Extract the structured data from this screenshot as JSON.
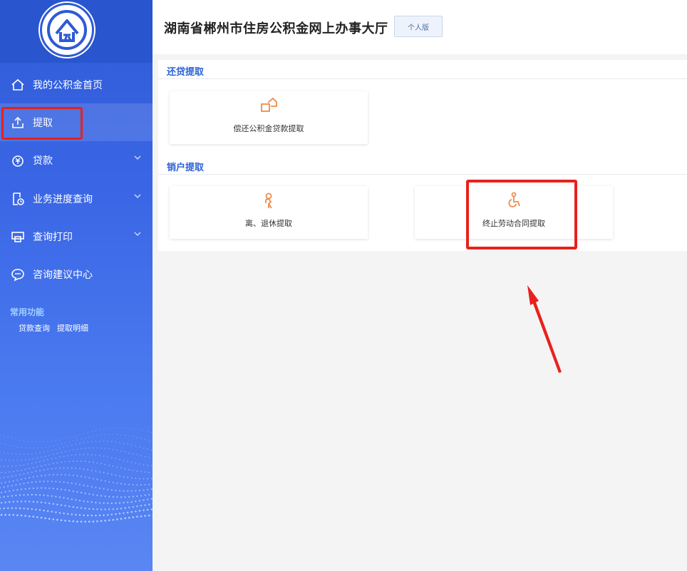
{
  "sidebar": {
    "items": [
      {
        "label": "我的公积金首页",
        "icon": "home-icon"
      },
      {
        "label": "提取",
        "icon": "upload-icon",
        "active": true
      },
      {
        "label": "贷款",
        "icon": "loan-icon",
        "has_submenu": true
      },
      {
        "label": "业务进度查询",
        "icon": "progress-doc-icon",
        "has_submenu": true
      },
      {
        "label": "查询打印",
        "icon": "printer-icon",
        "has_submenu": true
      },
      {
        "label": "咨询建议中心",
        "icon": "chat-bubble-icon"
      }
    ],
    "common": {
      "title": "常用功能",
      "links": [
        "贷款查询",
        "提取明细"
      ]
    }
  },
  "header": {
    "title": "湖南省郴州市住房公积金网上办事大厅",
    "version_button": "个人版"
  },
  "main": {
    "sections": [
      {
        "title": "还贷提取",
        "cards": [
          {
            "label": "偿还公积金贷款提取",
            "icon": "house-repay-icon"
          }
        ]
      },
      {
        "title": "销户提取",
        "cards": [
          {
            "label": "离、退休提取",
            "icon": "retiree-icon"
          },
          {
            "label": "终止劳动合同提取",
            "icon": "wheelchair-icon"
          }
        ]
      }
    ]
  },
  "colors": {
    "sidebar_blue": "#3b67e6",
    "accent_blue": "#2c63d8",
    "icon_orange": "#f08a4b",
    "annotation_red": "#e8211c"
  }
}
